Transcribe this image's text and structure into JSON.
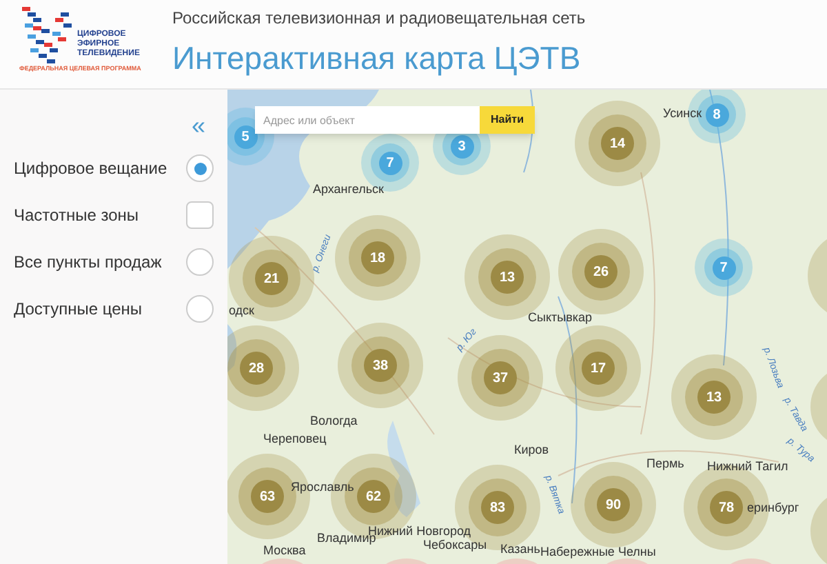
{
  "logo": {
    "lines": [
      "ЦИФРОВОЕ",
      "ЭФИРНОЕ",
      "ТЕЛЕВИДЕНИЕ"
    ],
    "tagline": "ФЕДЕРАЛЬНАЯ ЦЕЛЕВАЯ ПРОГРАММА"
  },
  "header": {
    "subtitle": "Российская телевизионная и радиовещательная сеть",
    "title": "Интерактивная карта ЦЭТВ"
  },
  "sidebar": {
    "collapse": "«",
    "layers": [
      {
        "label": "Цифровое вещание",
        "kind": "radio",
        "selected": true
      },
      {
        "label": "Частотные зоны",
        "kind": "checkbox",
        "selected": false
      },
      {
        "label": "Все пункты продаж",
        "kind": "radio",
        "selected": false
      },
      {
        "label": "Доступные цены",
        "kind": "radio",
        "selected": false
      }
    ]
  },
  "search": {
    "placeholder": "Адрес или объект",
    "button": "Найти"
  },
  "map": {
    "cities": [
      "Усинск",
      "Архангельск",
      "одск",
      "Сыктывкар",
      "Вологда",
      "Череповец",
      "Киров",
      "Пермь",
      "Нижний Тагил",
      "Ярославль",
      "еринбург",
      "Владимир",
      "Нижний Новгород",
      "Москва",
      "Чебоксары",
      "Казань",
      "Набережные Челны"
    ],
    "rivers": [
      "р. Онеги",
      "р. Юг",
      "р. Вятка",
      "р. Лозьва",
      "р. Тавда",
      "р. Тура"
    ],
    "clusters": [
      {
        "count": "5",
        "kind": "blue"
      },
      {
        "count": "7",
        "kind": "blue"
      },
      {
        "count": "3",
        "kind": "blue"
      },
      {
        "count": "14",
        "kind": "olive"
      },
      {
        "count": "8",
        "kind": "blue"
      },
      {
        "count": "21",
        "kind": "olive"
      },
      {
        "count": "18",
        "kind": "olive"
      },
      {
        "count": "13",
        "kind": "olive"
      },
      {
        "count": "26",
        "kind": "olive"
      },
      {
        "count": "7",
        "kind": "blue"
      },
      {
        "count": "28",
        "kind": "olive"
      },
      {
        "count": "38",
        "kind": "olive"
      },
      {
        "count": "37",
        "kind": "olive"
      },
      {
        "count": "17",
        "kind": "olive"
      },
      {
        "count": "13",
        "kind": "olive"
      },
      {
        "count": "63",
        "kind": "olive"
      },
      {
        "count": "62",
        "kind": "olive"
      },
      {
        "count": "83",
        "kind": "olive"
      },
      {
        "count": "90",
        "kind": "olive"
      },
      {
        "count": "78",
        "kind": "olive"
      }
    ]
  }
}
